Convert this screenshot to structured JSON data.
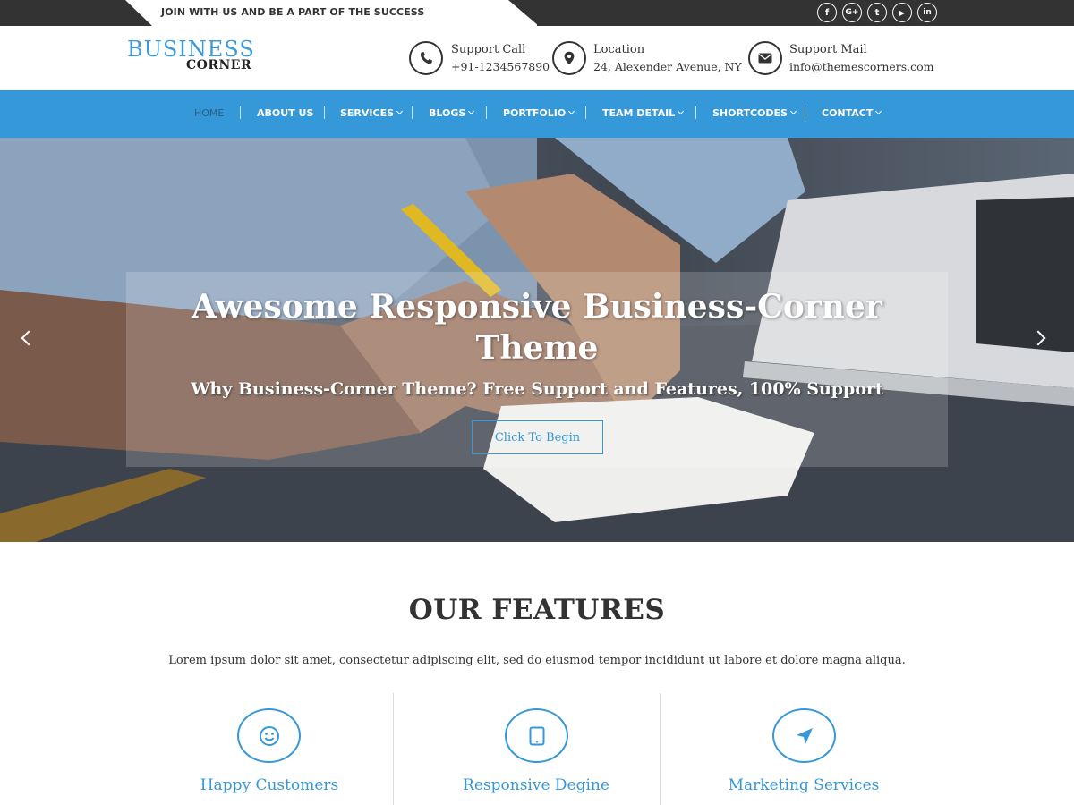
{
  "topbar": {
    "tagline": "JOIN WITH US AND BE A PART OF THE SUCCESS",
    "social": [
      {
        "icon": "facebook-icon",
        "glyph": "f"
      },
      {
        "icon": "google-plus-icon",
        "glyph": "G+"
      },
      {
        "icon": "twitter-icon",
        "glyph": "t"
      },
      {
        "icon": "youtube-icon",
        "glyph": "▶"
      },
      {
        "icon": "linkedin-icon",
        "glyph": "in"
      }
    ]
  },
  "header": {
    "logo_top": "BUSINESS",
    "logo_bottom": "CORNER",
    "contacts": [
      {
        "icon": "phone-icon",
        "label": "Support Call",
        "value": "+91-1234567890"
      },
      {
        "icon": "location-pin-icon",
        "label": "Location",
        "value": "24, Alexender Avenue, NY"
      },
      {
        "icon": "envelope-icon",
        "label": "Support Mail",
        "value": "info@themescorners.com"
      }
    ]
  },
  "nav": {
    "items": [
      {
        "label": "HOME",
        "active": true,
        "dropdown": false
      },
      {
        "label": "ABOUT US",
        "active": false,
        "dropdown": false
      },
      {
        "label": "SERVICES",
        "active": false,
        "dropdown": true
      },
      {
        "label": "BLOGS",
        "active": false,
        "dropdown": true
      },
      {
        "label": "PORTFOLIO",
        "active": false,
        "dropdown": true
      },
      {
        "label": "TEAM DETAIL",
        "active": false,
        "dropdown": true
      },
      {
        "label": "SHORTCODES",
        "active": false,
        "dropdown": true
      },
      {
        "label": "CONTACT",
        "active": false,
        "dropdown": true
      }
    ]
  },
  "hero": {
    "title_line1": "Awesome Responsive Business-Corner",
    "title_line2": "Theme",
    "subtitle": "Why Business-Corner Theme? Free Support and Features, 100% Support",
    "button_label": "Click To Begin"
  },
  "features": {
    "title": "OUR FEATURES",
    "description": "Lorem ipsum dolor sit amet, consectetur adipiscing elit, sed do eiusmod tempor incididunt ut labore et dolore magna aliqua.",
    "items": [
      {
        "icon": "smiley-icon",
        "title": "Happy Customers"
      },
      {
        "icon": "tablet-icon",
        "title": "Responsive Degine"
      },
      {
        "icon": "location-arrow-icon",
        "title": "Marketing Services"
      }
    ]
  },
  "colors": {
    "accent": "#3598d8",
    "topbar": "#333333",
    "text": "#333333"
  }
}
